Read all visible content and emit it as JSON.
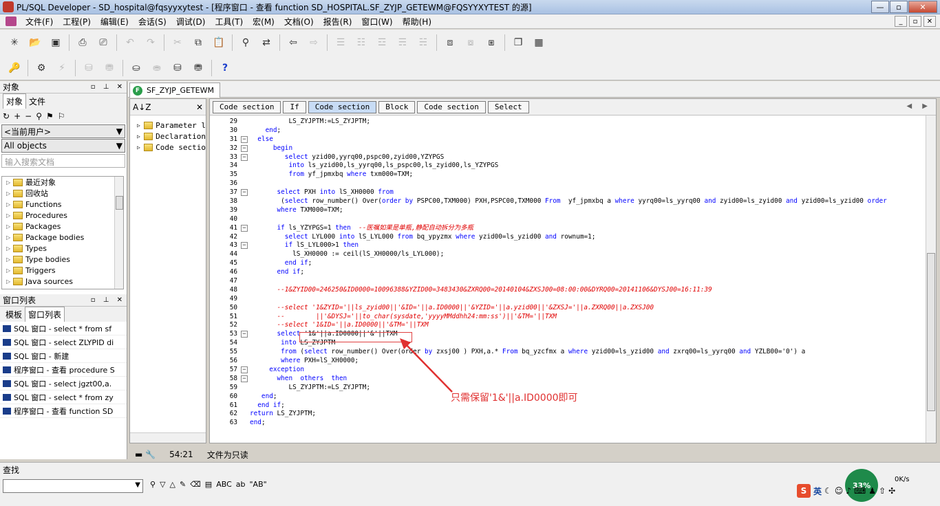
{
  "window": {
    "title": "PL/SQL Developer - SD_hospital@fqsyyxytest - [程序窗口 - 查看 function SD_HOSPITAL.SF_ZYJP_GETEWM@FQSYYXYTEST 的源]",
    "min": "—",
    "max": "▫",
    "close": "✕"
  },
  "menu": [
    "文件(F)",
    "工程(P)",
    "编辑(E)",
    "会话(S)",
    "调试(D)",
    "工具(T)",
    "宏(M)",
    "文档(O)",
    "报告(R)",
    "窗口(W)",
    "帮助(H)"
  ],
  "mdi_controls": [
    "_",
    "▫",
    "✕"
  ],
  "object_panel": {
    "header": "对象",
    "tabs": [
      "对象",
      "文件"
    ],
    "user_combo": "<当前用户>",
    "filter_combo": "All objects",
    "search_placeholder": "输入搜索文档",
    "tree": [
      "最近对象",
      "回收站",
      "Functions",
      "Procedures",
      "Packages",
      "Package bodies",
      "Types",
      "Type bodies",
      "Triggers",
      "Java sources"
    ]
  },
  "window_list": {
    "header": "窗口列表",
    "tabs": [
      "模板",
      "窗口列表"
    ],
    "items": [
      "SQL 窗口 - select * from sf",
      "SQL 窗口 - select ZLYPID di",
      "SQL 窗口 - 新建",
      "程序窗口 - 查看 procedure S",
      "SQL 窗口 - select jgzt00,a.",
      "SQL 窗口 - select * from zy",
      "程序窗口 - 查看 function SD"
    ]
  },
  "doc_tab": {
    "label": "SF_ZYJP_GETEWM",
    "icon": "F"
  },
  "outline": {
    "sort_label": "A↓Z",
    "close": "✕",
    "items": [
      "Parameter l",
      "Declaration",
      "Code sectio"
    ]
  },
  "crumbs": [
    "Code section",
    "If",
    "Code section",
    "Block",
    "Code section",
    "Select"
  ],
  "crumb_arrows": "◀ ▶",
  "code_lines": [
    {
      "n": "29",
      "f": "",
      "t": [
        [
          "",
          "          LS_ZYJPTM:=LS_ZYJPTM;"
        ]
      ]
    },
    {
      "n": "30",
      "f": "",
      "t": [
        [
          "kw",
          "    end"
        ],
        [
          "",
          ";"
        ]
      ]
    },
    {
      "n": "31",
      "f": "⊟",
      "t": [
        [
          "kw",
          "  else"
        ]
      ]
    },
    {
      "n": "32",
      "f": "⊟",
      "t": [
        [
          "kw",
          "      begin"
        ]
      ]
    },
    {
      "n": "33",
      "f": "⊟",
      "t": [
        [
          "kw",
          "         select"
        ],
        [
          "",
          " yzid00,yyrq00,pspc00,zyid00,YZYPGS"
        ]
      ]
    },
    {
      "n": "34",
      "f": "",
      "t": [
        [
          "kw",
          "          into"
        ],
        [
          "",
          " ls_yzid00,ls_yyrq00,ls_pspc00,ls_zyid00,ls_YZYPGS"
        ]
      ]
    },
    {
      "n": "35",
      "f": "",
      "t": [
        [
          "kw",
          "          from"
        ],
        [
          "",
          " yf_jpmxbq "
        ],
        [
          "kw",
          "where"
        ],
        [
          "",
          " txm000=TXM;"
        ]
      ]
    },
    {
      "n": "36",
      "f": "",
      "t": [
        [
          "",
          ""
        ]
      ]
    },
    {
      "n": "37",
      "f": "⊟",
      "t": [
        [
          "kw",
          "       select"
        ],
        [
          "",
          " PXH "
        ],
        [
          "kw",
          "into"
        ],
        [
          "",
          " lS_XH0000 "
        ],
        [
          "kw",
          "from"
        ]
      ]
    },
    {
      "n": "38",
      "f": "",
      "t": [
        [
          "",
          "        ("
        ],
        [
          "kw",
          "select"
        ],
        [
          "",
          " row_number() Over("
        ],
        [
          "kw",
          "order by"
        ],
        [
          "",
          " PSPC00,TXM000) PXH,PSPC00,TXM000 "
        ],
        [
          "kw",
          "From"
        ],
        [
          "",
          "  yf_jpmxbq a "
        ],
        [
          "kw",
          "where"
        ],
        [
          "",
          " yyrq00=ls_yyrq00 "
        ],
        [
          "kw",
          "and"
        ],
        [
          "",
          " zyid00=ls_zyid00 "
        ],
        [
          "kw",
          "and"
        ],
        [
          "",
          " yzid00=ls_yzid00 "
        ],
        [
          "kw",
          "order"
        ]
      ]
    },
    {
      "n": "39",
      "f": "",
      "t": [
        [
          "kw",
          "       where"
        ],
        [
          "",
          " TXM000=TXM;"
        ]
      ]
    },
    {
      "n": "40",
      "f": "",
      "t": [
        [
          "",
          ""
        ]
      ]
    },
    {
      "n": "41",
      "f": "⊟",
      "t": [
        [
          "kw",
          "       if"
        ],
        [
          "",
          " ls_YZYPGS=1 "
        ],
        [
          "kw",
          "then"
        ],
        [
          "cm",
          "  --医嘱如果是单瓶,静配自动拆分为多瓶"
        ]
      ]
    },
    {
      "n": "42",
      "f": "",
      "t": [
        [
          "kw",
          "         select"
        ],
        [
          "",
          " LYL000 "
        ],
        [
          "kw",
          "into"
        ],
        [
          "",
          " lS_LYL000 "
        ],
        [
          "kw",
          "from"
        ],
        [
          "",
          " bq_ypyzmx "
        ],
        [
          "kw",
          "where"
        ],
        [
          "",
          " yzid00=ls_yzid00 "
        ],
        [
          "kw",
          "and"
        ],
        [
          "",
          " rownum=1;"
        ]
      ]
    },
    {
      "n": "43",
      "f": "⊟",
      "t": [
        [
          "kw",
          "         if"
        ],
        [
          "",
          " lS_LYL000>1 "
        ],
        [
          "kw",
          "then"
        ]
      ]
    },
    {
      "n": "44",
      "f": "",
      "t": [
        [
          "",
          "           lS_XH0000 := ceil(lS_XH0000/ls_LYL000);"
        ]
      ]
    },
    {
      "n": "45",
      "f": "",
      "t": [
        [
          "kw",
          "         end if"
        ],
        [
          "",
          ";"
        ]
      ]
    },
    {
      "n": "46",
      "f": "",
      "t": [
        [
          "kw",
          "       end if"
        ],
        [
          "",
          ";"
        ]
      ]
    },
    {
      "n": "47",
      "f": "",
      "t": [
        [
          "",
          ""
        ]
      ]
    },
    {
      "n": "48",
      "f": "",
      "t": [
        [
          "cm",
          "       --1&ZYID00=246250&ID0000=10096388&YZID00=3483430&ZXRQ00=20140104&ZXSJ00=08:00:00&DYRQ00=20141106&DYSJ00=16:11:39"
        ]
      ]
    },
    {
      "n": "49",
      "f": "",
      "t": [
        [
          "",
          ""
        ]
      ]
    },
    {
      "n": "50",
      "f": "",
      "t": [
        [
          "cm",
          "       --select '1&ZYID='||ls_zyid00||'&ID='||a.ID0000||'&YZID='||a.yzid00||'&ZXSJ='||a.ZXRQ00||a.ZXSJ00"
        ]
      ]
    },
    {
      "n": "51",
      "f": "",
      "t": [
        [
          "cm",
          "       --        ||'&DYSJ='||to_char(sysdate,'yyyyMMddhh24:mm:ss')||'&TM='||TXM"
        ]
      ]
    },
    {
      "n": "52",
      "f": "",
      "t": [
        [
          "cm",
          "       --select '1&ID='||a.ID0000||'&TM='||TXM"
        ]
      ]
    },
    {
      "n": "53",
      "f": "⊟",
      "t": [
        [
          "kw",
          "       select"
        ],
        [
          "",
          " '1&'||a.ID0000||'&'||TXM"
        ]
      ]
    },
    {
      "n": "54",
      "f": "",
      "t": [
        [
          "kw",
          "        into"
        ],
        [
          "",
          " LS_ZYJPTM"
        ]
      ]
    },
    {
      "n": "55",
      "f": "",
      "t": [
        [
          "kw",
          "        from"
        ],
        [
          "",
          " ("
        ],
        [
          "kw",
          "select"
        ],
        [
          "",
          " row_number() Over(order "
        ],
        [
          "kw",
          "by"
        ],
        [
          "",
          " zxsj00 ) PXH,a.* "
        ],
        [
          "kw",
          "From"
        ],
        [
          "",
          " bq_yzcfmx a "
        ],
        [
          "kw",
          "where"
        ],
        [
          "",
          " yzid00=ls_yzid00 "
        ],
        [
          "kw",
          "and"
        ],
        [
          "",
          " zxrq00=ls_yyrq00 "
        ],
        [
          "kw",
          "and"
        ],
        [
          "",
          " YZLB00='0') a"
        ]
      ]
    },
    {
      "n": "56",
      "f": "",
      "t": [
        [
          "kw",
          "        where"
        ],
        [
          "",
          " PXH=lS_XH0000;"
        ]
      ]
    },
    {
      "n": "57",
      "f": "⊟",
      "t": [
        [
          "kw",
          "     exception"
        ]
      ]
    },
    {
      "n": "58",
      "f": "⊟",
      "t": [
        [
          "kw",
          "       when  others  then"
        ]
      ]
    },
    {
      "n": "59",
      "f": "",
      "t": [
        [
          "",
          "          LS_ZYJPTM:=LS_ZYJPTM;"
        ]
      ]
    },
    {
      "n": "60",
      "f": "",
      "t": [
        [
          "kw",
          "   end"
        ],
        [
          "",
          ";"
        ]
      ]
    },
    {
      "n": "61",
      "f": "",
      "t": [
        [
          "kw",
          "  end if"
        ],
        [
          "",
          ";"
        ]
      ]
    },
    {
      "n": "62",
      "f": "",
      "t": [
        [
          "kw",
          "return"
        ],
        [
          "",
          " LS_ZYJPTM;"
        ]
      ]
    },
    {
      "n": "63",
      "f": "",
      "t": [
        [
          "kw",
          "end"
        ],
        [
          "",
          ";"
        ]
      ]
    }
  ],
  "annotation": "只需保留'1&'||a.ID0000即可",
  "status": {
    "position": "54:21",
    "mode": "文件为只读"
  },
  "find": {
    "label": "查找",
    "abc": "ABC",
    "ab_quoted": "\"AB\""
  },
  "tray": {
    "gauge": "33%",
    "net": "0K/s",
    "ime": "S",
    "lang": "英"
  },
  "colors": {
    "keyword": "#0000ff",
    "comment": "#e00000",
    "annotation": "#e03030"
  }
}
